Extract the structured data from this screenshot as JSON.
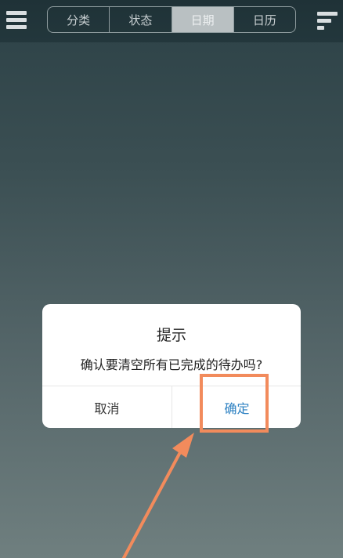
{
  "tabs": [
    {
      "label": "分类",
      "active": false
    },
    {
      "label": "状态",
      "active": false
    },
    {
      "label": "日期",
      "active": true
    },
    {
      "label": "日历",
      "active": false
    }
  ],
  "dialog": {
    "title": "提示",
    "message": "确认要清空所有已完成的待办吗?",
    "cancel_label": "取消",
    "confirm_label": "确定"
  },
  "icons": {
    "menu": "hamburger-menu-icon",
    "filter": "filter-sort-icon"
  },
  "colors": {
    "topbar": "#1f3237",
    "active_tab": "#b9c0c2",
    "confirm_text": "#2a7fc1",
    "annotation": "#f28b5c"
  }
}
